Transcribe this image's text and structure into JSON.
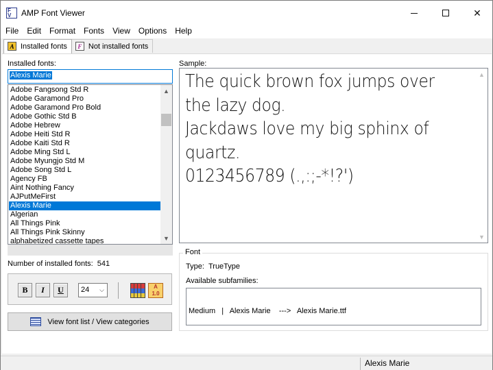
{
  "window": {
    "title": "AMP Font Viewer",
    "minimize_symbol": "",
    "maximize_symbol": "",
    "close_symbol": "✕"
  },
  "menu": [
    "File",
    "Edit",
    "Format",
    "Fonts",
    "View",
    "Options",
    "Help"
  ],
  "tabs": [
    {
      "label": "Installed fonts",
      "icon": "installed-fonts-icon",
      "active": true
    },
    {
      "label": "Not installed fonts",
      "icon": "not-installed-fonts-icon",
      "active": false
    }
  ],
  "installed": {
    "label": "Installed fonts:",
    "search_value": "Alexis Marie",
    "fonts": [
      "Adobe Fangsong Std R",
      "Adobe Garamond Pro",
      "Adobe Garamond Pro Bold",
      "Adobe Gothic Std B",
      "Adobe Hebrew",
      "Adobe Heiti Std R",
      "Adobe Kaiti Std R",
      "Adobe Ming Std L",
      "Adobe Myungjo Std M",
      "Adobe Song Std L",
      "Agency FB",
      "Aint Nothing Fancy",
      "AJPutMeFirst",
      "Alexis Marie",
      "Algerian",
      "All Things Pink",
      "All Things Pink Skinny",
      "alphabetized cassette tapes"
    ],
    "selected_font": "Alexis Marie",
    "count_label": "Number of installed fonts:",
    "count_value": "541"
  },
  "format": {
    "bold_label": "B",
    "italic_label": "I",
    "underline_label": "U",
    "size_value": "24",
    "size_caret": "⌵",
    "charmap_icon": "character-map-icon",
    "compare_icon": "compare-fonts-icon"
  },
  "view_button_label": "View font list / View categories",
  "sample": {
    "label": "Sample:",
    "text": "The quick brown fox jumps over the lazy dog.\nJackdaws love my big sphinx of quartz.\n0123456789 (.,:;-*!?')"
  },
  "font_info": {
    "legend": "Font",
    "type_label": "Type:",
    "type_value": "TrueType",
    "subfamilies_label": "Available subfamilies:",
    "subfamily_entry": "Medium   |   Alexis Marie    --->   Alexis Marie.ttf"
  },
  "status": {
    "font_name": "Alexis Marie"
  },
  "colors": {
    "selection": "#0078d7",
    "window_bg": "#f0f0f0",
    "panel_bg": "#ffffff"
  }
}
